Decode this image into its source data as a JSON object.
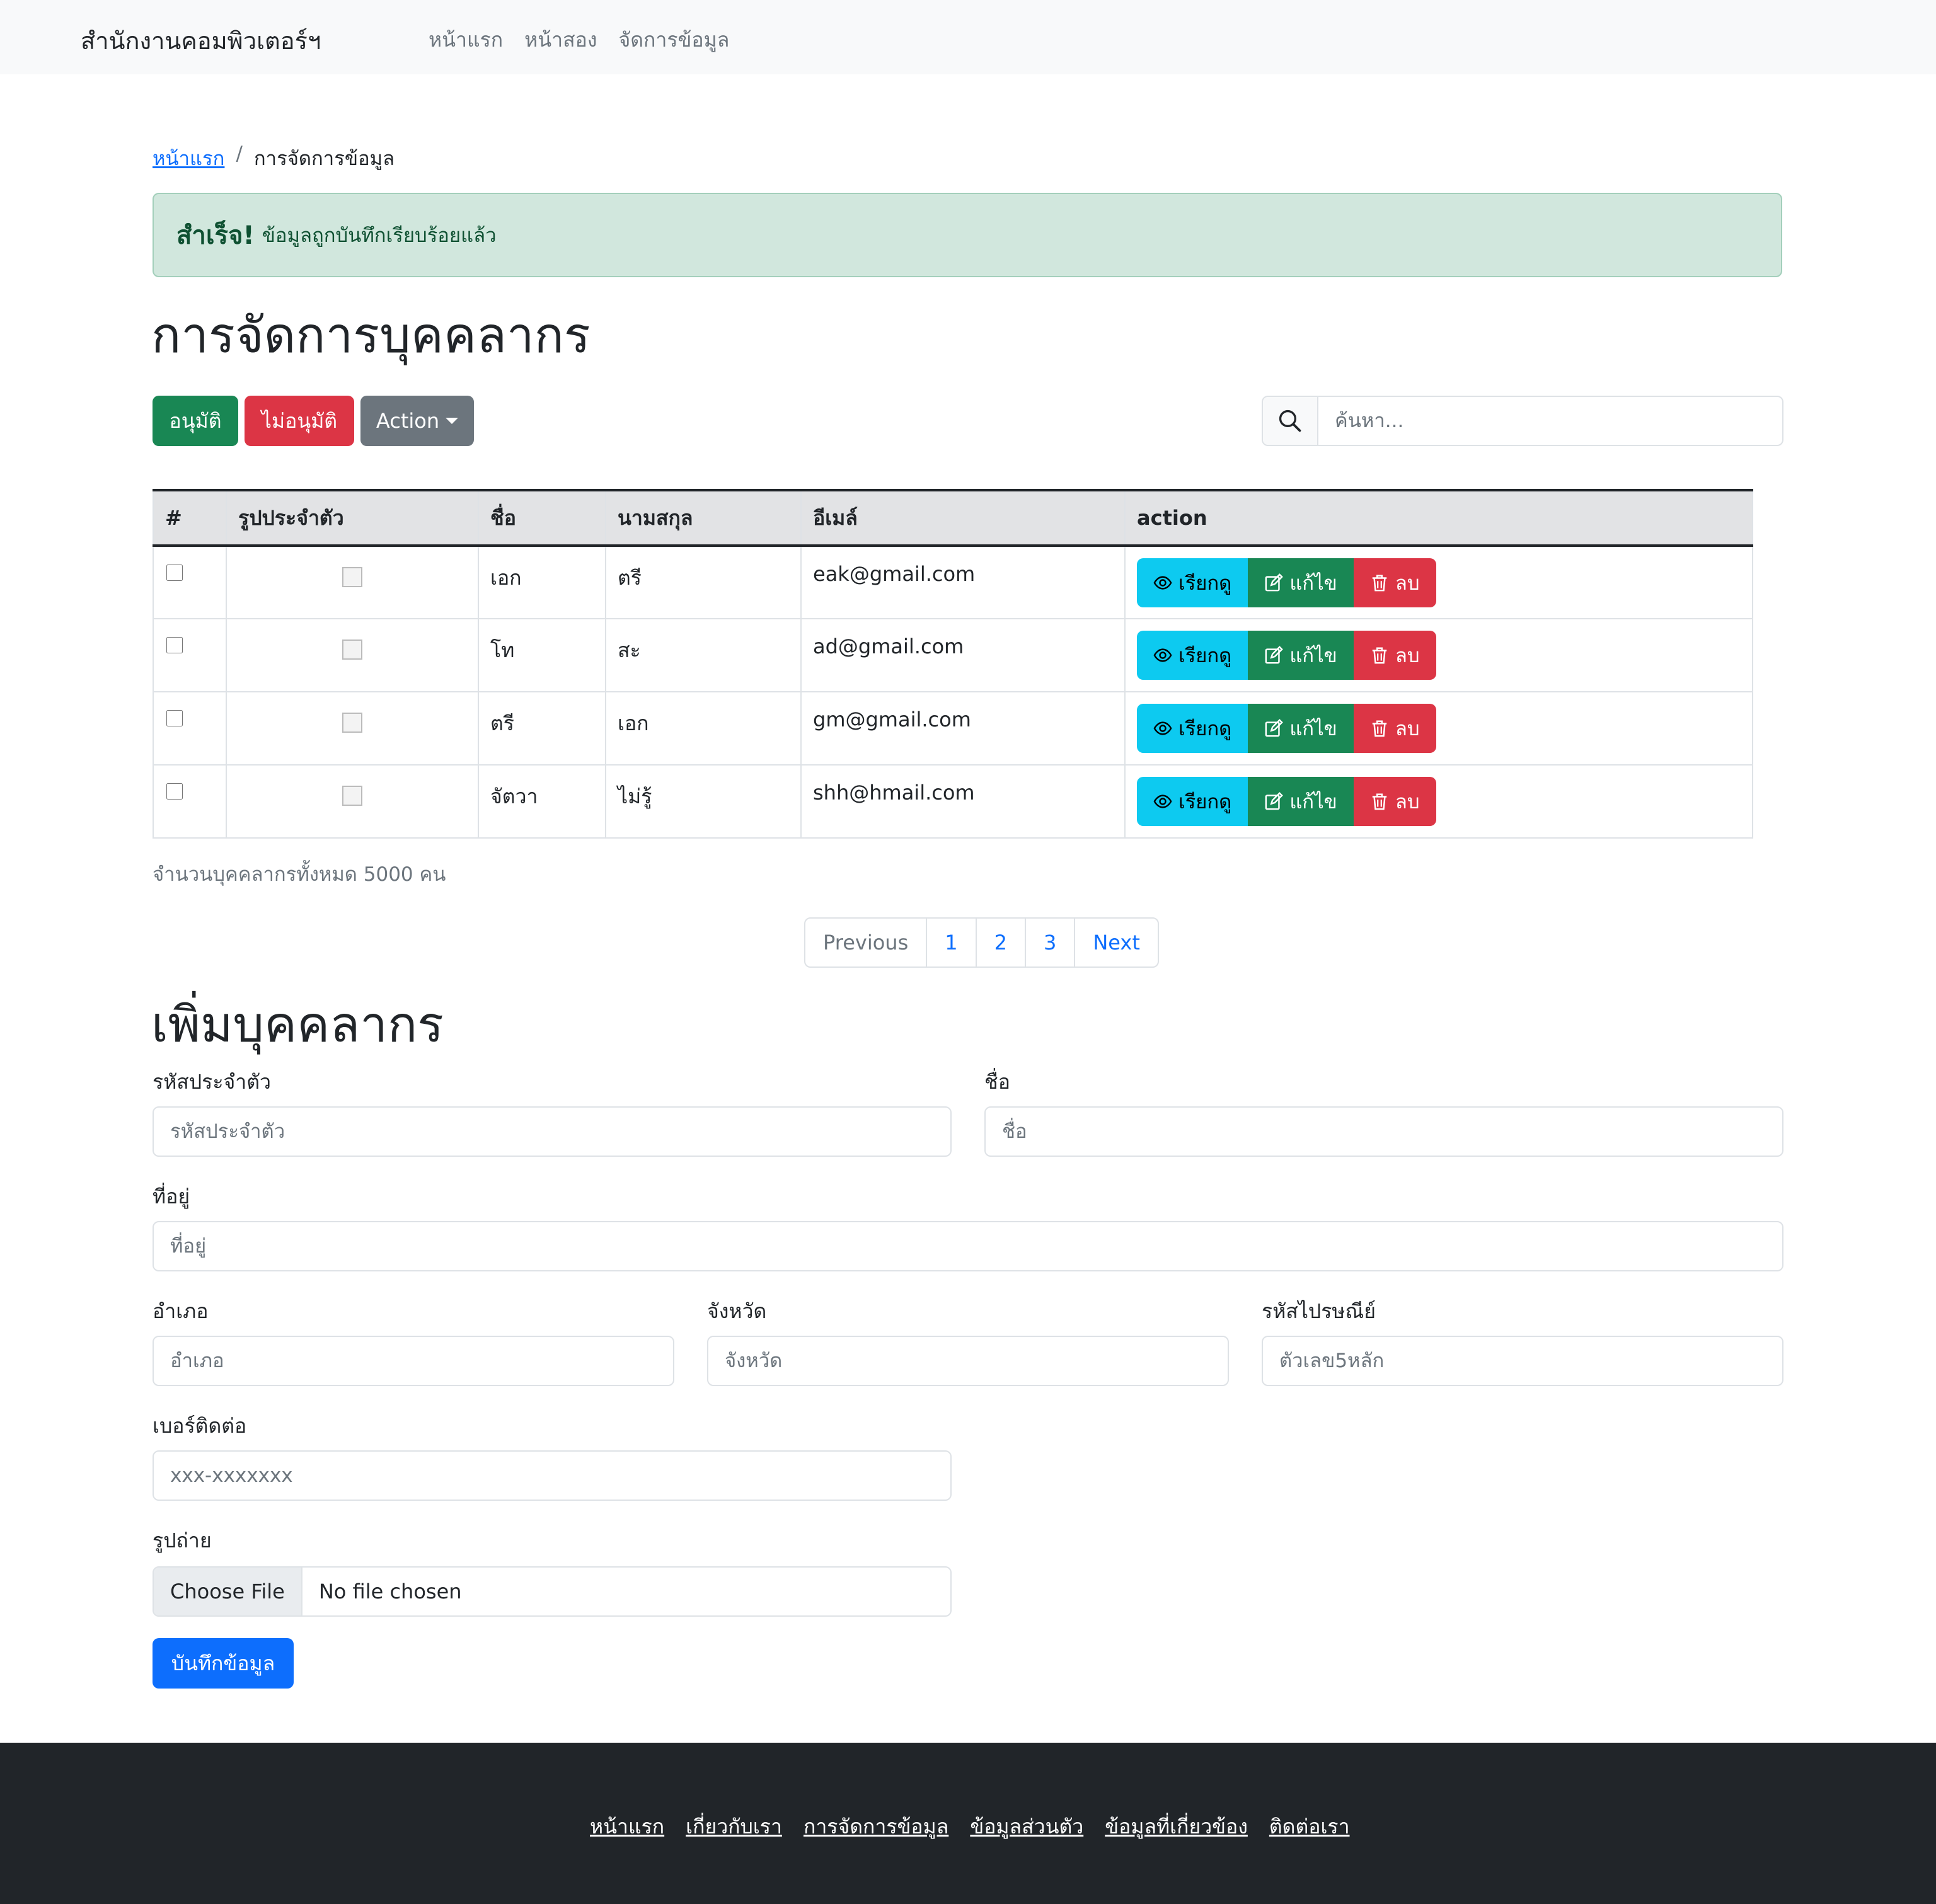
{
  "navbar": {
    "brand": "สำนักงานคอมพิวเตอร์ฯ",
    "links": [
      "หน้าแรก",
      "หน้าสอง",
      "จัดการข้อมูล"
    ]
  },
  "breadcrumb": {
    "home": "หน้าแรก",
    "separator": "/",
    "current": "การจัดการข้อมูล"
  },
  "alert": {
    "strong": "สำเร็จ!",
    "text": "ข้อมูลถูกบันทึกเรียบร้อยแล้ว"
  },
  "page_title": "การจัดการบุคคลากร",
  "toolbar": {
    "approve": "อนุมัติ",
    "reject": "ไม่อนุมัติ",
    "action": "Action",
    "search_placeholder": "ค้นหา..."
  },
  "table": {
    "headers": [
      "#",
      "รูปประจำตัว",
      "ชื่อ",
      "นามสกุล",
      "อีเมล์",
      "action"
    ],
    "rows": [
      {
        "first_name": "เอก",
        "last_name": "ตรี",
        "email": "eak@gmail.com"
      },
      {
        "first_name": "โท",
        "last_name": "สะ",
        "email": "ad@gmail.com"
      },
      {
        "first_name": "ตรี",
        "last_name": "เอก",
        "email": "gm@gmail.com"
      },
      {
        "first_name": "จัตวา",
        "last_name": "ไม่รู้",
        "email": "shh@hmail.com"
      }
    ],
    "action_labels": {
      "view": "เรียกดู",
      "edit": "แก้ไข",
      "delete": "ลบ"
    }
  },
  "total_text": "จำนวนบุคคลากรทั้งหมด 5000 คน",
  "pagination": {
    "previous": "Previous",
    "pages": [
      "1",
      "2",
      "3"
    ],
    "next": "Next"
  },
  "form": {
    "title": "เพิ่มบุคคลากร",
    "id_label": "รหัสประจำตัว",
    "id_placeholder": "รหัสประจำตัว",
    "name_label": "ชื่อ",
    "name_placeholder": "ชื่อ",
    "address_label": "ที่อยู่",
    "address_placeholder": "ที่อยู่",
    "district_label": "อำเภอ",
    "district_placeholder": "อำเภอ",
    "province_label": "จังหวัด",
    "province_placeholder": "จังหวัด",
    "zip_label": "รหัสไปรษณีย์",
    "zip_placeholder": "ตัวเลข5หลัก",
    "phone_label": "เบอร์ติดต่อ",
    "phone_placeholder": "xxx-xxxxxxx",
    "photo_label": "รูปถ่าย",
    "file_button": "Choose File",
    "file_status": "No file chosen",
    "submit": "บันทึกข้อมูล"
  },
  "footer": {
    "links": [
      "หน้าแรก",
      "เกี่ยวกับเรา",
      "การจัดการข้อมูล",
      "ข้อมูลส่วนตัว",
      "ข้อมูลที่เกี่ยวข้อง",
      "ติดต่อเรา"
    ]
  },
  "colors": {
    "success": "#198754",
    "danger": "#dc3545",
    "secondary": "#6c757d",
    "primary": "#0d6efd",
    "info": "#0dcaf0",
    "alert_bg": "#d1e7dd",
    "footer_bg": "#212529"
  }
}
